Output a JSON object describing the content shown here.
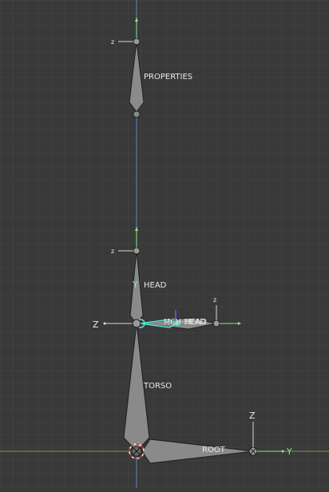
{
  "viewport": {
    "background": "#393939",
    "grid_color": "#454545",
    "vertical_axis_color": "#5a86c6",
    "horizontal_axis_color": "#7f9a3a"
  },
  "bones": {
    "properties": {
      "label": "PROPERTIES"
    },
    "head": {
      "label": "HEAD"
    },
    "mch_head": {
      "label": "MCH-HEAD"
    },
    "torso": {
      "label": "TORSO"
    },
    "root": {
      "label": "ROOT"
    }
  },
  "axes": {
    "z": "z",
    "z_upper": "Z",
    "y": "y",
    "y_upper": "Y"
  },
  "colors": {
    "bone_fill": "#8a8a8a",
    "bone_stroke": "#1e1e1e",
    "selected_bone": "#59e3d6",
    "axis_line": "#d8d8d8",
    "y_axis_green": "#8fe68f",
    "z_axis_white": "#e8e8ff"
  }
}
